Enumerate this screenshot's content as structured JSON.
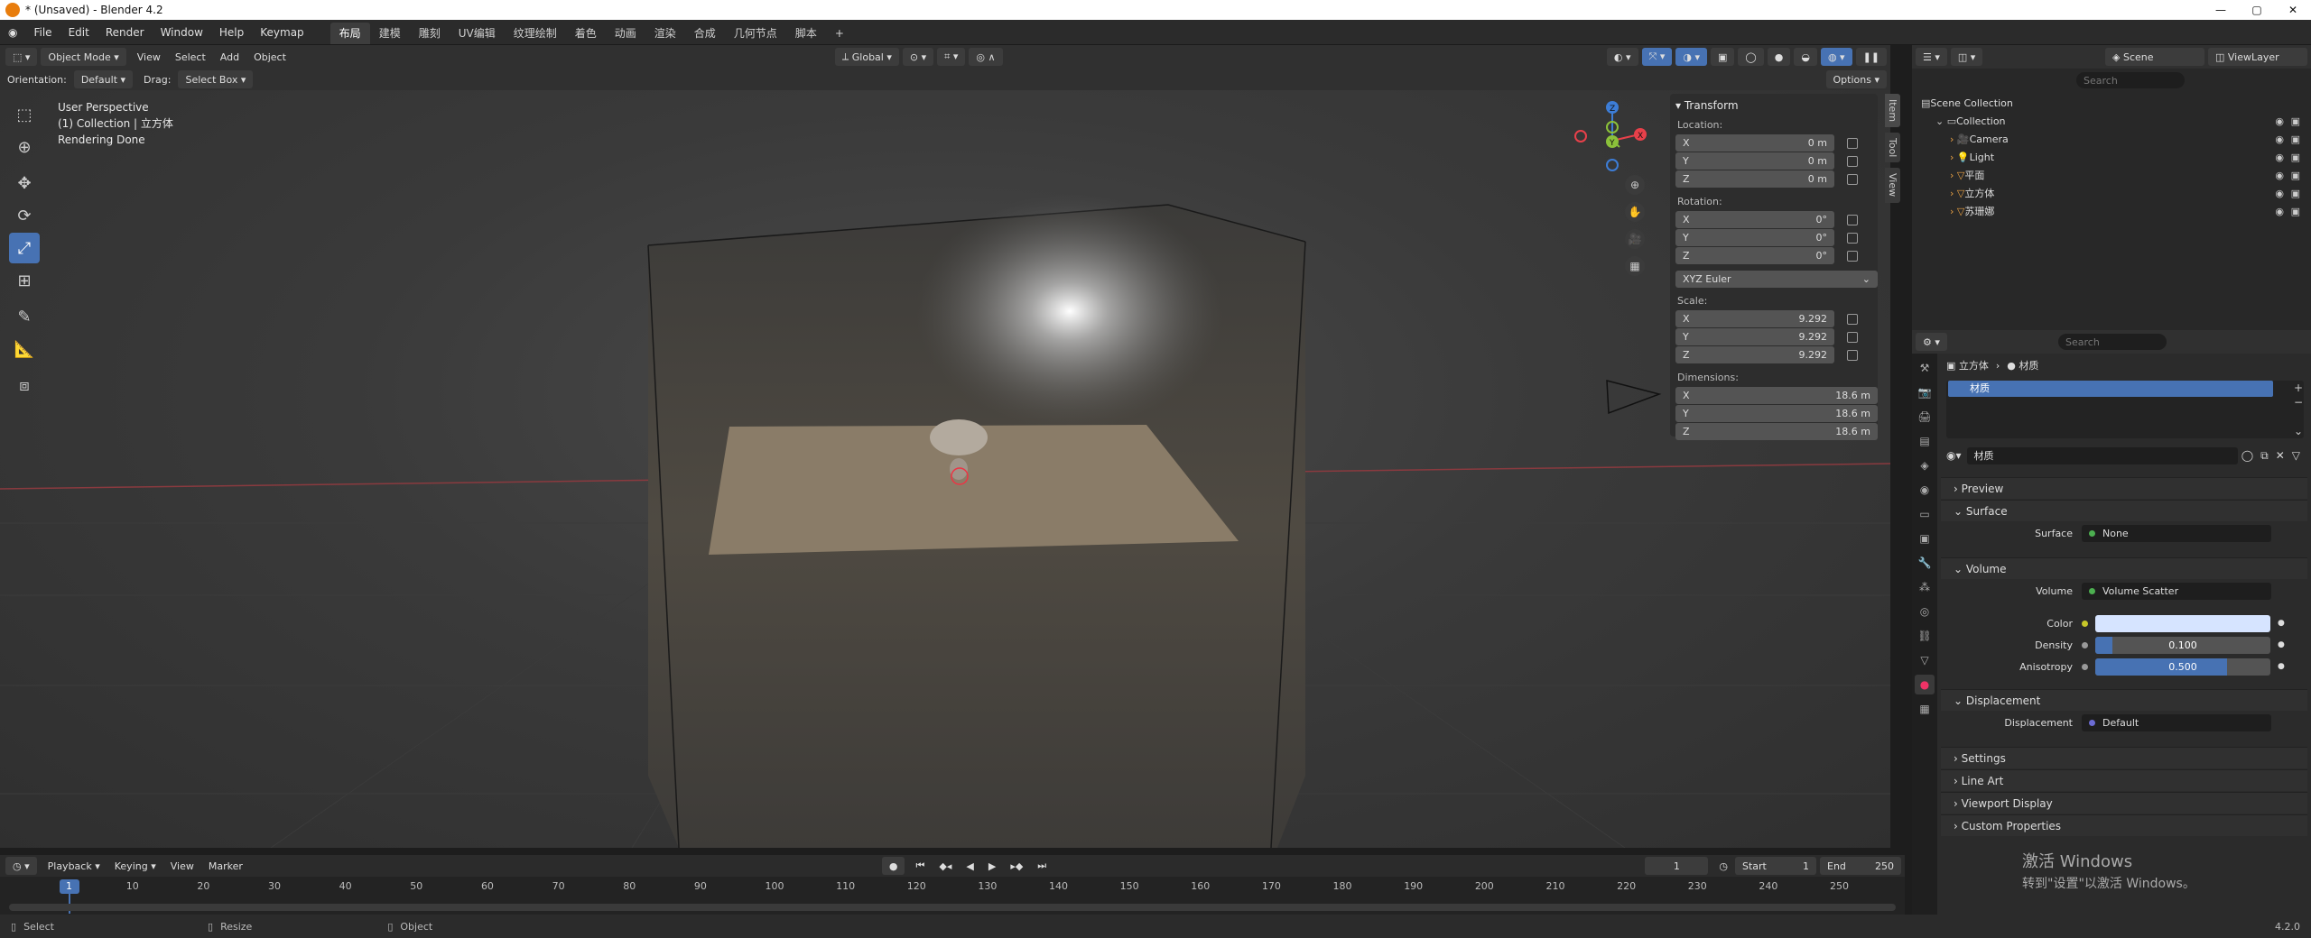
{
  "window": {
    "title": "* (Unsaved) - Blender 4.2"
  },
  "menus": [
    "File",
    "Edit",
    "Render",
    "Window",
    "Help",
    "Keymap"
  ],
  "workspaces": [
    "布局",
    "建模",
    "雕刻",
    "UV编辑",
    "纹理绘制",
    "着色",
    "动画",
    "渲染",
    "合成",
    "几何节点",
    "脚本"
  ],
  "viewport_header": {
    "mode": "Object Mode",
    "items": [
      "View",
      "Select",
      "Add",
      "Object"
    ],
    "transform": "Global"
  },
  "viewport_tool": {
    "orientation_label": "Orientation:",
    "orientation": "Default",
    "drag_label": "Drag:",
    "drag": "Select Box",
    "options": "Options"
  },
  "overlay_text": [
    "User Perspective",
    "(1) Collection | 立方体",
    "Rendering Done"
  ],
  "transform_panel": {
    "title": "Transform",
    "location_label": "Location:",
    "location": {
      "x": "0 m",
      "y": "0 m",
      "z": "0 m"
    },
    "rotation_label": "Rotation:",
    "rotation": {
      "x": "0°",
      "y": "0°",
      "z": "0°"
    },
    "rotation_mode": "XYZ Euler",
    "scale_label": "Scale:",
    "scale": {
      "x": "9.292",
      "y": "9.292",
      "z": "9.292"
    },
    "dimensions_label": "Dimensions:",
    "dimensions": {
      "x": "18.6 m",
      "y": "18.6 m",
      "z": "18.6 m"
    },
    "axis": {
      "x": "X",
      "y": "Y",
      "z": "Z"
    }
  },
  "side_tabs": [
    "Item",
    "Tool",
    "View"
  ],
  "timeline": {
    "items": [
      "Playback",
      "Keying",
      "View",
      "Marker"
    ],
    "current_frame": "1",
    "start_label": "Start",
    "start": "1",
    "end_label": "End",
    "end": "250",
    "ticks": [
      "1",
      "10",
      "20",
      "30",
      "40",
      "50",
      "60",
      "70",
      "80",
      "90",
      "100",
      "110",
      "120",
      "130",
      "140",
      "150",
      "160",
      "170",
      "180",
      "190",
      "200",
      "210",
      "220",
      "230",
      "240",
      "250"
    ]
  },
  "status_bar": {
    "select": "Select",
    "resize": "Resize",
    "object": "Object",
    "version": "4.2.0"
  },
  "outliner": {
    "scene": "Scene",
    "view_layer": "ViewLayer",
    "search_placeholder": "Search",
    "rows": [
      {
        "label": "Scene Collection",
        "indent": 0
      },
      {
        "label": "Collection",
        "indent": 1
      },
      {
        "label": "Camera",
        "indent": 2
      },
      {
        "label": "Light",
        "indent": 2
      },
      {
        "label": "平面",
        "indent": 2
      },
      {
        "label": "立方体",
        "indent": 2
      },
      {
        "label": "苏珊娜",
        "indent": 2
      }
    ]
  },
  "properties": {
    "search_placeholder": "Search",
    "breadcrumb": {
      "object": "立方体",
      "material": "材质"
    },
    "slot": "材质",
    "material_name": "材质",
    "sections": {
      "preview": "Preview",
      "surface": "Surface",
      "volume": "Volume",
      "displacement": "Displacement",
      "settings": "Settings",
      "line_art": "Line Art",
      "viewport_display": "Viewport Display",
      "custom_properties": "Custom Properties"
    },
    "surface_label": "Surface",
    "surface_value": "None",
    "volume_label": "Volume",
    "volume_value": "Volume Scatter",
    "color_label": "Color",
    "color_value": "#d6e4ff",
    "density_label": "Density",
    "density_value": "0.100",
    "density_fraction": 0.1,
    "anisotropy_label": "Anisotropy",
    "anisotropy_value": "0.500",
    "anisotropy_fraction": 0.75,
    "displacement_label": "Displacement",
    "displacement_value": "Default"
  },
  "watermark": {
    "line1": "激活 Windows",
    "line2": "转到\"设置\"以激活 Windows。"
  },
  "colors": {
    "accent": "#4772b3",
    "x_axis": "#e8404a",
    "y_axis": "#8bc13a",
    "z_axis": "#3d7dd6"
  }
}
